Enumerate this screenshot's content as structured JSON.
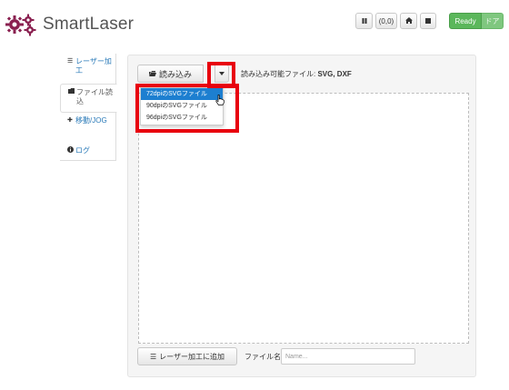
{
  "app": {
    "title": "SmartLaser"
  },
  "toolbar": {
    "coords": "(0,0)",
    "status_ready": "Ready",
    "status_door": "ドア"
  },
  "sidebar": {
    "items": [
      {
        "label": "レーザー加工",
        "icon": "list-icon",
        "active": false
      },
      {
        "label": "ファイル読込",
        "icon": "folder-icon",
        "active": true
      },
      {
        "label": "移動/JOG",
        "icon": "move-icon",
        "active": false
      },
      {
        "label": "ログ",
        "icon": "info-icon",
        "active": false
      }
    ]
  },
  "main": {
    "load_button": "読み込み",
    "formats_prefix": "読み込み可能ファイル: ",
    "formats_value": "SVG, DXF",
    "dropdown": [
      "72dpiのSVGファイル",
      "90dpiのSVGファイル",
      "96dpiのSVGファイル"
    ],
    "add_button": "レーザー加工に追加",
    "filename_label": "ファイル名",
    "filename_placeholder": "Name..."
  },
  "colors": {
    "ready_green": "#5bb75b",
    "highlight_red": "#e8000e",
    "selection_blue": "#1d7fd0",
    "link_blue": "#2a7ab8"
  }
}
